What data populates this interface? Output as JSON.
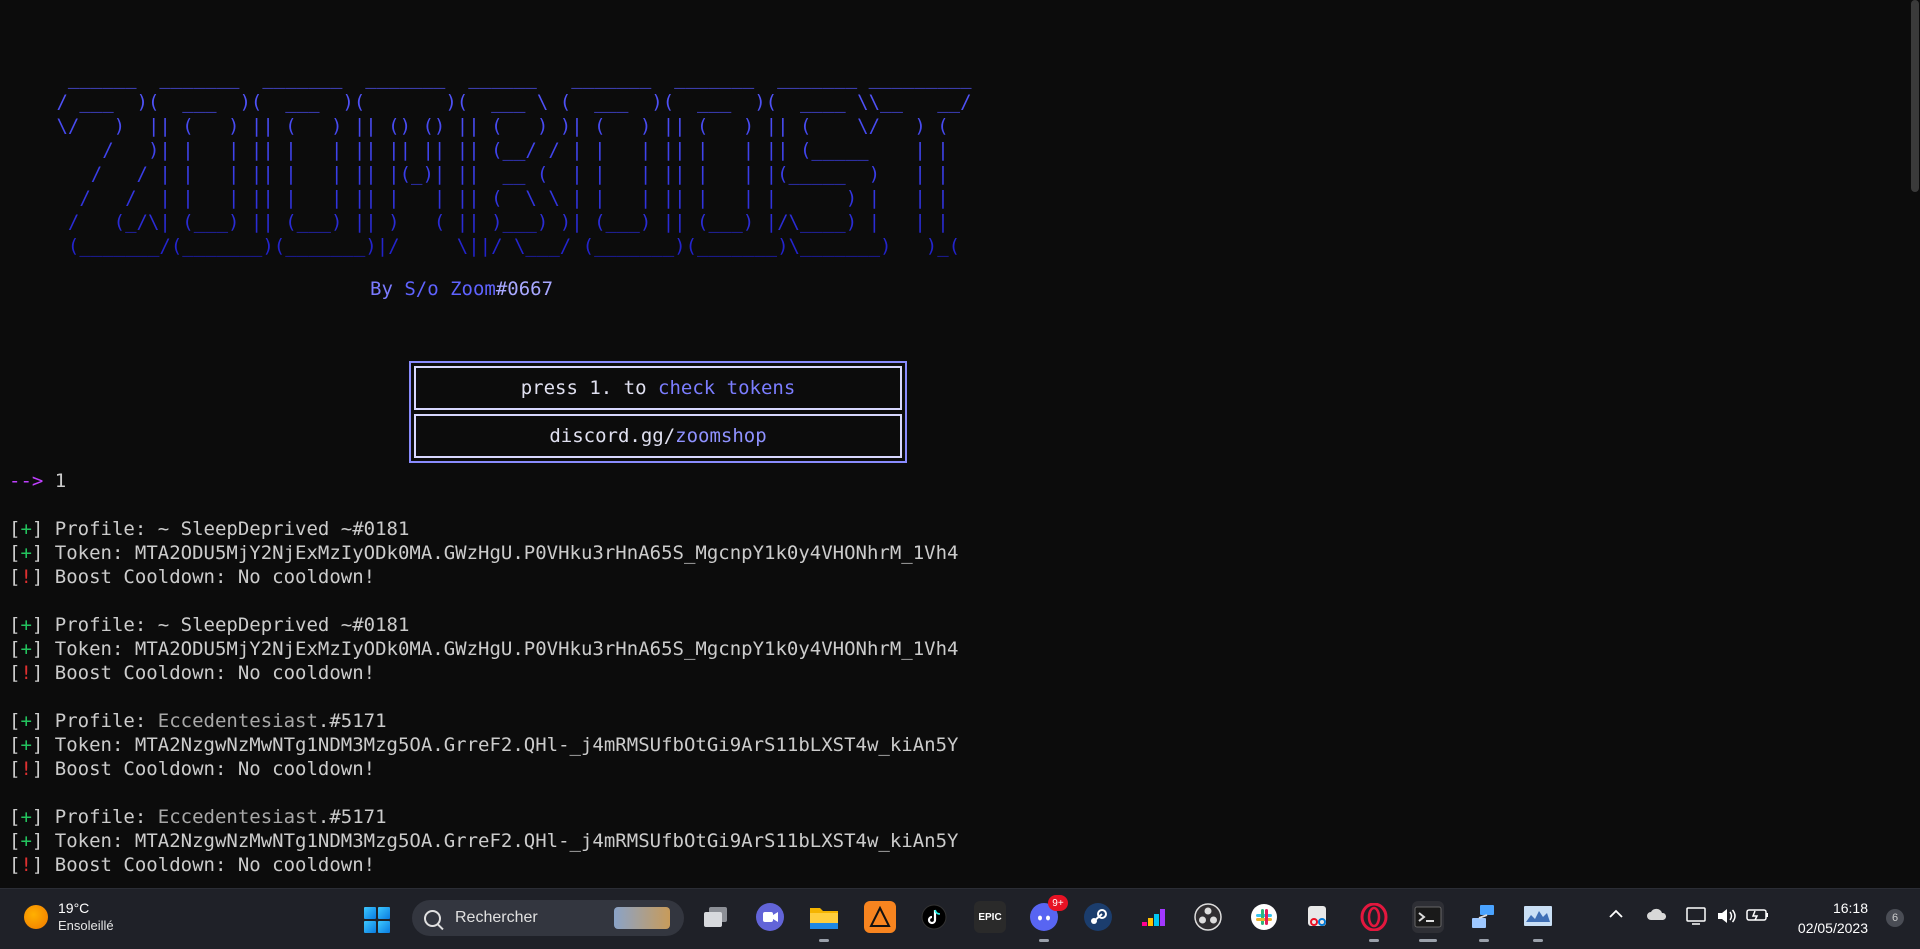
{
  "terminal": {
    "banner_lines": [
      "  ______  _______  _______  _______  ______   _______  _______  _______ _________",
      " / ___  )(  ___  )(  ___  )(       )(  ___ \\ (  ___  )(  ___  )(  ____ \\\\__   __/",
      " \\/   )  || (   ) || (   ) || () () || (   ) )| (   ) || (   ) || (    \\/   ) (",
      "     /   )| |   | || |   | || || || || (__/ / | |   | || |   | || (_____    | |",
      "    /   / | |   | || |   | || |(_)| ||  __ (  | |   | || |   | |(_____  )   | |",
      "   /   /  | |   | || |   | || |   | || (  \\ \\ | |   | || |   | |      ) |   | |",
      "  /   (_/\\| (___) || (___) || )   ( || )___) )| (___) || (___) |/\\____) |   | |",
      "  (_______/(_______)(_______)|/     \\||/ \\___/ (_______)(_______)\\_______)   )_("
    ],
    "byline": {
      "by": "By ",
      "author": "S/o Zoom",
      "tag": "#0667"
    },
    "menu": {
      "option1_prefix": "press 1. to ",
      "option1_action": "check tokens",
      "link_prefix": "discord.gg/",
      "link_path": "zoomshop"
    },
    "prompt": {
      "arrow": "-->",
      "input": " 1"
    },
    "results": [
      {
        "profile": "~ SleepDeprived ~#0181",
        "token": "MTA2ODU5MjY2NjExMzIyODk0MA.GWzHgU.P0VHku3rHnA65S_MgcnpY1k0y4VHONhrM_1Vh4",
        "cooldown": "No cooldown!"
      },
      {
        "profile": "~ SleepDeprived ~#0181",
        "token": "MTA2ODU5MjY2NjExMzIyODk0MA.GWzHgU.P0VHku3rHnA65S_MgcnpY1k0y4VHONhrM_1Vh4",
        "cooldown": "No cooldown!"
      },
      {
        "profile_name": "Eccedentesiast",
        "profile_tag": ".#5171",
        "token": "MTA2NzgwNzMwNTg1NDM3Mzg5OA.GrreF2.QHl-_j4mRMSUfbOtGi9ArS11bLXST4w_kiAn5Y",
        "cooldown": "No cooldown!"
      },
      {
        "profile_name": "Eccedentesiast",
        "profile_tag": ".#5171",
        "token": "MTA2NzgwNzMwNTg1NDM3Mzg5OA.GrreF2.QHl-_j4mRMSUfbOtGi9ArS11bLXST4w_kiAn5Y",
        "cooldown": "No cooldown!"
      }
    ],
    "labels": {
      "plus": "+",
      "bang": "!",
      "profile": " Profile: ",
      "token": " Token: ",
      "cooldown": " Boost Cooldown: "
    }
  },
  "taskbar": {
    "weather": {
      "temp": "19°C",
      "condition": "Ensoleillé",
      "icon": "sun-icon"
    },
    "search_placeholder": "Rechercher",
    "apps": [
      "windows-start-icon",
      "task-view-icon",
      "teams-meet-icon",
      "file-explorer-icon",
      "fl-studio-icon",
      "tiktok-icon",
      "epic-games-icon",
      "discord-icon",
      "steam-icon",
      "deezer-icon",
      "obs-icon",
      "slack-icon",
      "snipping-tool-icon",
      "opera-gx-icon",
      "terminal-icon",
      "network-icon",
      "monitor-icon"
    ],
    "discord_badge": "9+",
    "epic_label": "EPIC",
    "clock": {
      "time": "16:18",
      "date": "02/05/2023"
    },
    "notification_count": "6"
  },
  "colors": {
    "terminal_bg": "#0c0c0c",
    "banner_blue": "#3a3ee8",
    "plus_green": "#23c45e",
    "bang_red": "#e03030",
    "arrow_purple": "#c040ff",
    "taskbar_bg": "#1f2128"
  }
}
